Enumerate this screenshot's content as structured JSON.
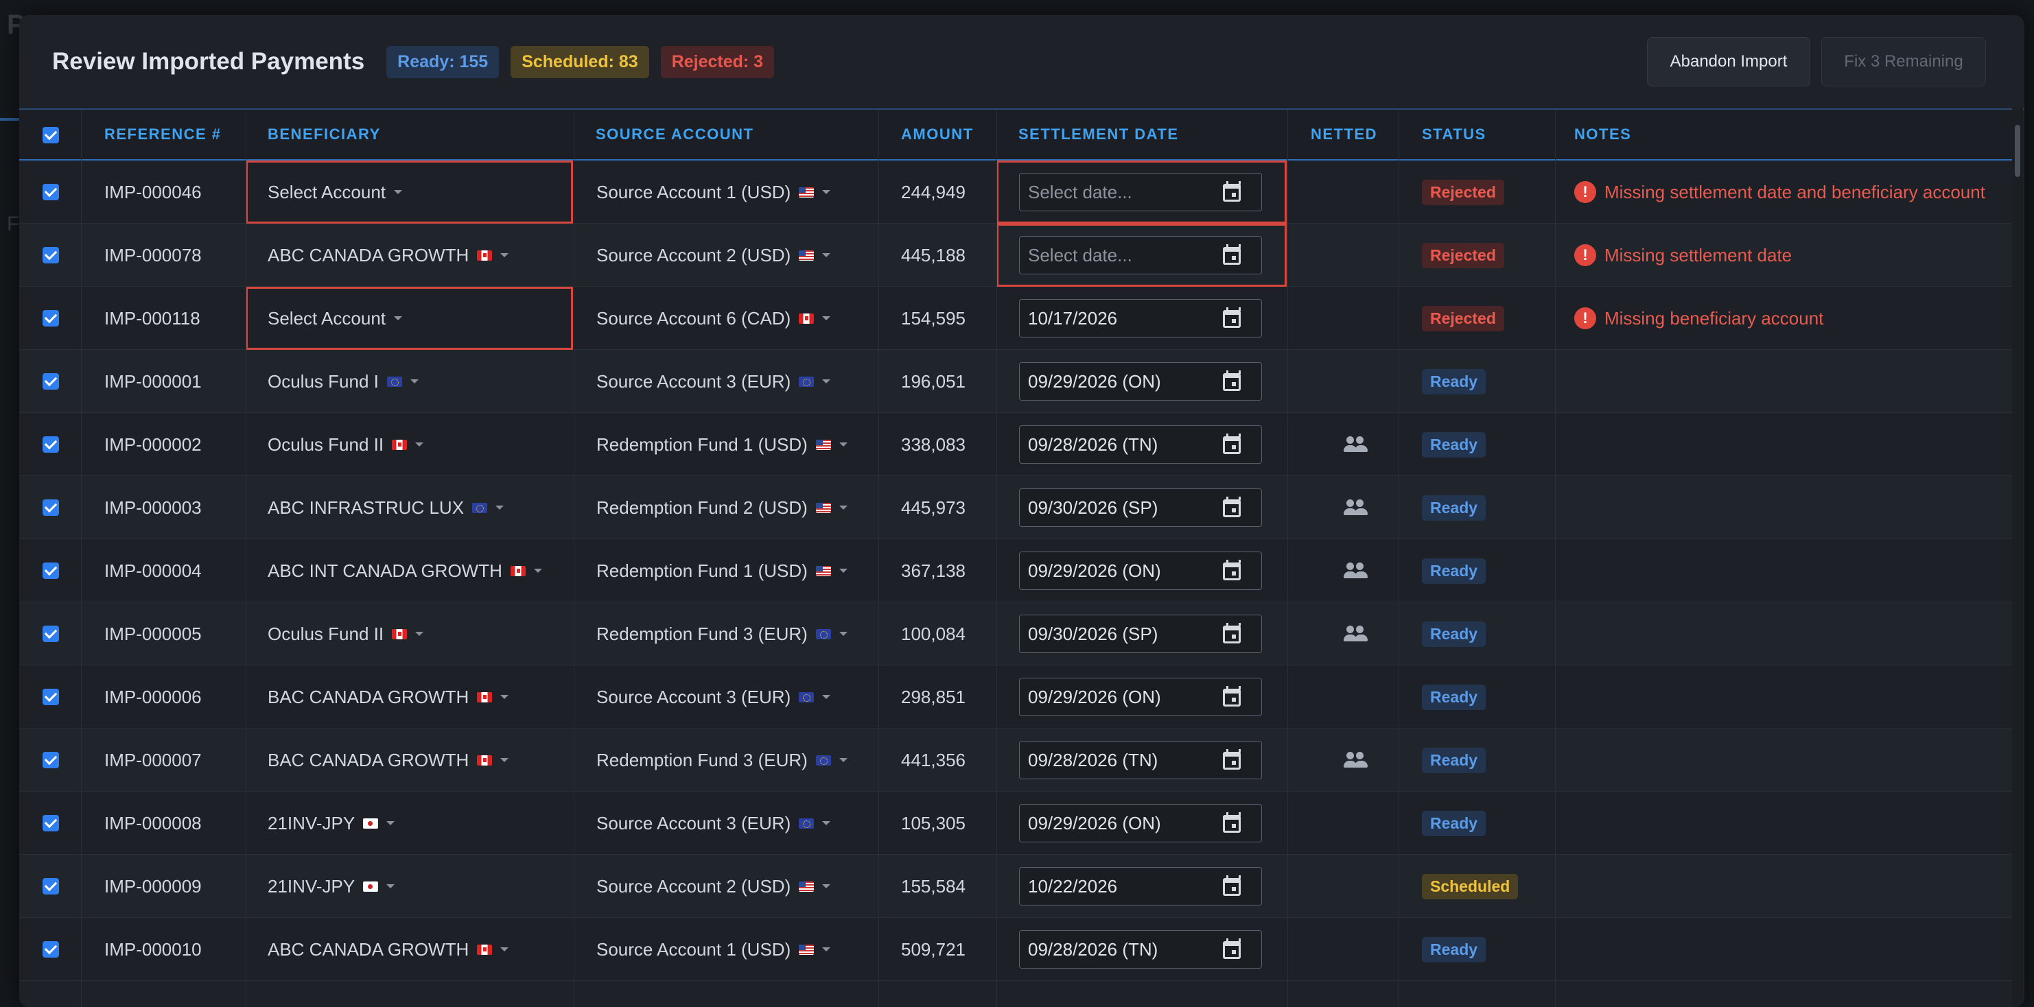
{
  "background": {
    "title": "P",
    "sub": "F"
  },
  "modal": {
    "title": "Review Imported Payments",
    "badges": {
      "ready": "Ready: 155",
      "scheduled": "Scheduled: 83",
      "rejected": "Rejected: 3"
    },
    "buttons": {
      "abandon": "Abandon Import",
      "fix": "Fix 3 Remaining"
    }
  },
  "columns": {
    "reference": "REFERENCE #",
    "beneficiary": "BENEFICIARY",
    "source": "SOURCE ACCOUNT",
    "amount": "AMOUNT",
    "settlement": "SETTLEMENT DATE",
    "netted": "NETTED",
    "status": "STATUS",
    "notes": "NOTES"
  },
  "rows": [
    {
      "ref": "IMP-000046",
      "beneficiary": "Select Account",
      "ben_flag": "",
      "source": "Source Account 1 (USD)",
      "src_flag": "us",
      "amount": "244,949",
      "date": "Select date...",
      "date_placeholder": true,
      "netted": false,
      "status": "Rejected",
      "note": "Missing settlement date and beneficiary account",
      "ben_err": true,
      "date_err": true
    },
    {
      "ref": "IMP-000078",
      "beneficiary": "ABC CANADA GROWTH",
      "ben_flag": "ca",
      "source": "Source Account 2 (USD)",
      "src_flag": "us",
      "amount": "445,188",
      "date": "Select date...",
      "date_placeholder": true,
      "netted": false,
      "status": "Rejected",
      "note": "Missing settlement date",
      "ben_err": false,
      "date_err": true
    },
    {
      "ref": "IMP-000118",
      "beneficiary": "Select Account",
      "ben_flag": "",
      "source": "Source Account 6 (CAD)",
      "src_flag": "ca",
      "amount": "154,595",
      "date": "10/17/2026",
      "date_placeholder": false,
      "netted": false,
      "status": "Rejected",
      "note": "Missing beneficiary account",
      "ben_err": true,
      "date_err": false
    },
    {
      "ref": "IMP-000001",
      "beneficiary": "Oculus Fund I",
      "ben_flag": "eu",
      "source": "Source Account 3 (EUR)",
      "src_flag": "eu",
      "amount": "196,051",
      "date": "09/29/2026 (ON)",
      "date_placeholder": false,
      "netted": false,
      "status": "Ready",
      "note": ""
    },
    {
      "ref": "IMP-000002",
      "beneficiary": "Oculus Fund II",
      "ben_flag": "ca",
      "source": "Redemption Fund 1 (USD)",
      "src_flag": "us",
      "amount": "338,083",
      "date": "09/28/2026 (TN)",
      "date_placeholder": false,
      "netted": true,
      "status": "Ready",
      "note": ""
    },
    {
      "ref": "IMP-000003",
      "beneficiary": "ABC INFRASTRUC LUX",
      "ben_flag": "eu",
      "source": "Redemption Fund 2 (USD)",
      "src_flag": "us",
      "amount": "445,973",
      "date": "09/30/2026 (SP)",
      "date_placeholder": false,
      "netted": true,
      "status": "Ready",
      "note": ""
    },
    {
      "ref": "IMP-000004",
      "beneficiary": "ABC INT CANADA GROWTH",
      "ben_flag": "ca",
      "source": "Redemption Fund 1 (USD)",
      "src_flag": "us",
      "amount": "367,138",
      "date": "09/29/2026 (ON)",
      "date_placeholder": false,
      "netted": true,
      "status": "Ready",
      "note": ""
    },
    {
      "ref": "IMP-000005",
      "beneficiary": "Oculus Fund II",
      "ben_flag": "ca",
      "source": "Redemption Fund 3 (EUR)",
      "src_flag": "eu",
      "amount": "100,084",
      "date": "09/30/2026 (SP)",
      "date_placeholder": false,
      "netted": true,
      "status": "Ready",
      "note": ""
    },
    {
      "ref": "IMP-000006",
      "beneficiary": "BAC CANADA GROWTH",
      "ben_flag": "ca",
      "source": "Source Account 3 (EUR)",
      "src_flag": "eu",
      "amount": "298,851",
      "date": "09/29/2026 (ON)",
      "date_placeholder": false,
      "netted": false,
      "status": "Ready",
      "note": ""
    },
    {
      "ref": "IMP-000007",
      "beneficiary": "BAC CANADA GROWTH",
      "ben_flag": "ca",
      "source": "Redemption Fund 3 (EUR)",
      "src_flag": "eu",
      "amount": "441,356",
      "date": "09/28/2026 (TN)",
      "date_placeholder": false,
      "netted": true,
      "status": "Ready",
      "note": ""
    },
    {
      "ref": "IMP-000008",
      "beneficiary": "21INV-JPY",
      "ben_flag": "jp",
      "source": "Source Account 3 (EUR)",
      "src_flag": "eu",
      "amount": "105,305",
      "date": "09/29/2026 (ON)",
      "date_placeholder": false,
      "netted": false,
      "status": "Ready",
      "note": ""
    },
    {
      "ref": "IMP-000009",
      "beneficiary": "21INV-JPY",
      "ben_flag": "jp",
      "source": "Source Account 2 (USD)",
      "src_flag": "us",
      "amount": "155,584",
      "date": "10/22/2026",
      "date_placeholder": false,
      "netted": false,
      "status": "Scheduled",
      "note": ""
    },
    {
      "ref": "IMP-000010",
      "beneficiary": "ABC CANADA GROWTH",
      "ben_flag": "ca",
      "source": "Source Account 1 (USD)",
      "src_flag": "us",
      "amount": "509,721",
      "date": "09/28/2026 (TN)",
      "date_placeholder": false,
      "netted": false,
      "status": "Ready",
      "note": ""
    }
  ]
}
